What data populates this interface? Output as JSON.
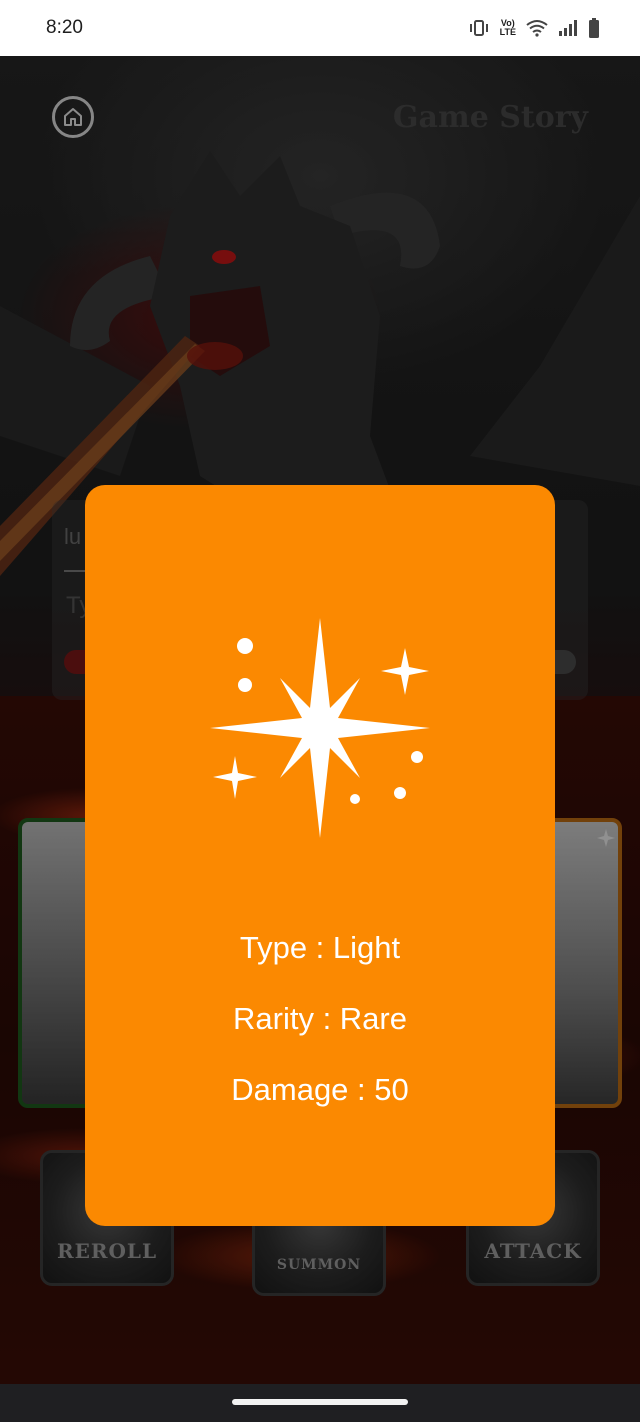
{
  "status_bar": {
    "time": "8:20",
    "icons": [
      "vibrate-icon",
      "volte-icon",
      "wifi-icon",
      "signal-icon",
      "battery-icon"
    ],
    "lte_label_top": "Vo)",
    "lte_label_bottom": "LTE"
  },
  "game": {
    "title": "Game Story",
    "home_icon": "home-icon",
    "input_value": "lu",
    "input_placeholder": "Ty",
    "actions": {
      "reroll": "REROLL",
      "summon": "SUMMON",
      "attack": "ATTACK"
    }
  },
  "modal": {
    "icon": "sparkle-icon",
    "background_color": "#fb8901",
    "type": "Type : Light",
    "rarity": "Rarity : Rare",
    "damage": "Damage : 50"
  }
}
